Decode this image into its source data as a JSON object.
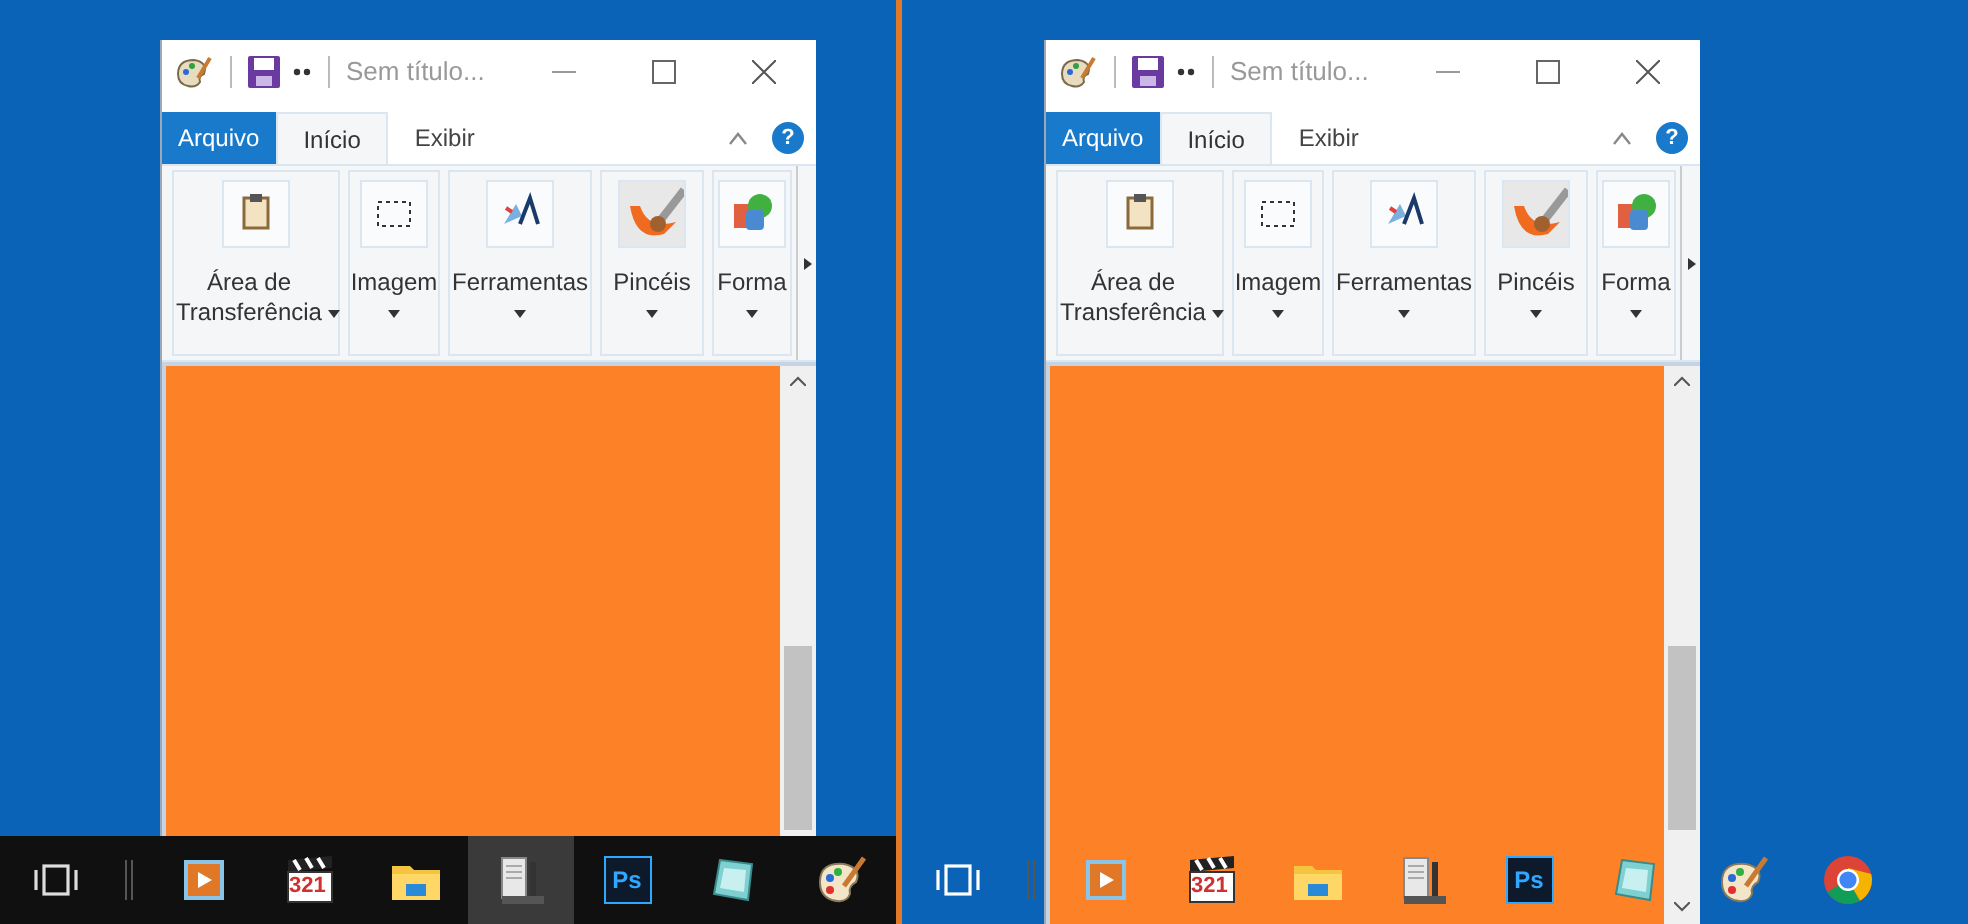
{
  "panels": [
    {
      "kind": "dark",
      "window": {
        "title": "Sem título...",
        "tabs": [
          {
            "label": "Arquivo",
            "kind": "file"
          },
          {
            "label": "Início",
            "kind": "tab",
            "selected": true
          },
          {
            "label": "Exibir",
            "kind": "tab",
            "selected": false
          }
        ],
        "help": "?",
        "groups": [
          {
            "label": "Área de Transferência",
            "kind": "clipboard"
          },
          {
            "label": "Imagem",
            "kind": "image"
          },
          {
            "label": "Ferramentas",
            "kind": "tools"
          },
          {
            "label": "Pincéis",
            "kind": "brushes"
          },
          {
            "label": "Forma",
            "kind": "shapes"
          }
        ]
      },
      "taskbar": [
        {
          "kind": "taskview",
          "active": false
        },
        {
          "kind": "separator"
        },
        {
          "kind": "media",
          "active": false
        },
        {
          "kind": "clapper",
          "label": "321",
          "active": false
        },
        {
          "kind": "folder",
          "active": false
        },
        {
          "kind": "document",
          "active": true
        },
        {
          "kind": "ps",
          "label": "Ps",
          "active": false
        },
        {
          "kind": "tablet",
          "active": false
        },
        {
          "kind": "palette",
          "active": false
        }
      ]
    },
    {
      "kind": "transparent",
      "window": {
        "title": "Sem título...",
        "tabs": [
          {
            "label": "Arquivo",
            "kind": "file"
          },
          {
            "label": "Início",
            "kind": "tab",
            "selected": true
          },
          {
            "label": "Exibir",
            "kind": "tab",
            "selected": false
          }
        ],
        "help": "?",
        "groups": [
          {
            "label": "Área de Transferência",
            "kind": "clipboard"
          },
          {
            "label": "Imagem",
            "kind": "image"
          },
          {
            "label": "Ferramentas",
            "kind": "tools"
          },
          {
            "label": "Pincéis",
            "kind": "brushes"
          },
          {
            "label": "Forma",
            "kind": "shapes"
          }
        ]
      },
      "taskbar": [
        {
          "kind": "taskview",
          "active": false
        },
        {
          "kind": "separator"
        },
        {
          "kind": "media",
          "active": false
        },
        {
          "kind": "clapper",
          "label": "321",
          "active": false
        },
        {
          "kind": "folder",
          "active": false
        },
        {
          "kind": "document",
          "active": false
        },
        {
          "kind": "ps",
          "label": "Ps",
          "active": false
        },
        {
          "kind": "tablet",
          "active": false
        },
        {
          "kind": "palette",
          "active": false
        },
        {
          "kind": "chrome",
          "active": false
        }
      ]
    }
  ]
}
